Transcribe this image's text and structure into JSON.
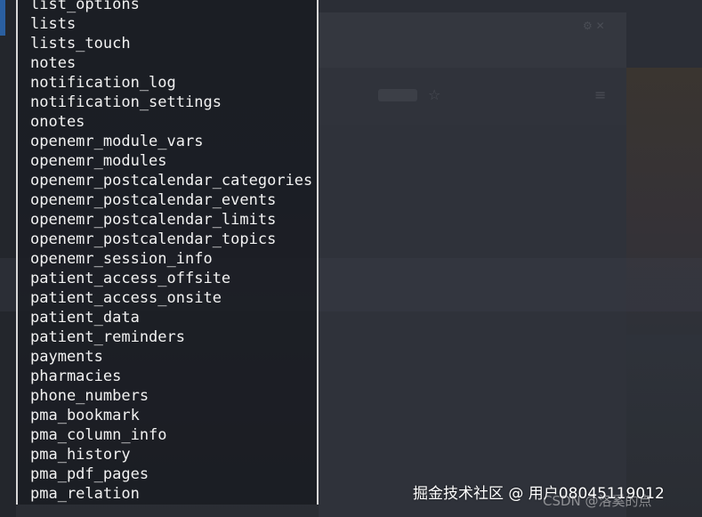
{
  "terminal": {
    "lines": [
      "list_options",
      "lists",
      "lists_touch",
      "notes",
      "notification_log",
      "notification_settings",
      "onotes",
      "openemr_module_vars",
      "openemr_modules",
      "openemr_postcalendar_categories",
      "openemr_postcalendar_events",
      "openemr_postcalendar_limits",
      "openemr_postcalendar_topics",
      "openemr_session_info",
      "patient_access_offsite",
      "patient_access_onsite",
      "patient_data",
      "patient_reminders",
      "payments",
      "pharmacies",
      "phone_numbers",
      "pma_bookmark",
      "pma_column_info",
      "pma_history",
      "pma_pdf_pages",
      "pma_relation"
    ]
  },
  "watermark": {
    "main": "掘金技术社区 @ 用户08045119012",
    "sub": "CSDN @洛奚的点"
  },
  "icons": {
    "star": "☆",
    "menu": "≡",
    "window_controls": "⚙ ✕"
  },
  "colors": {
    "terminal_bg": "#181b21",
    "text": "#f2f2f2",
    "border": "#d8d8d8"
  }
}
